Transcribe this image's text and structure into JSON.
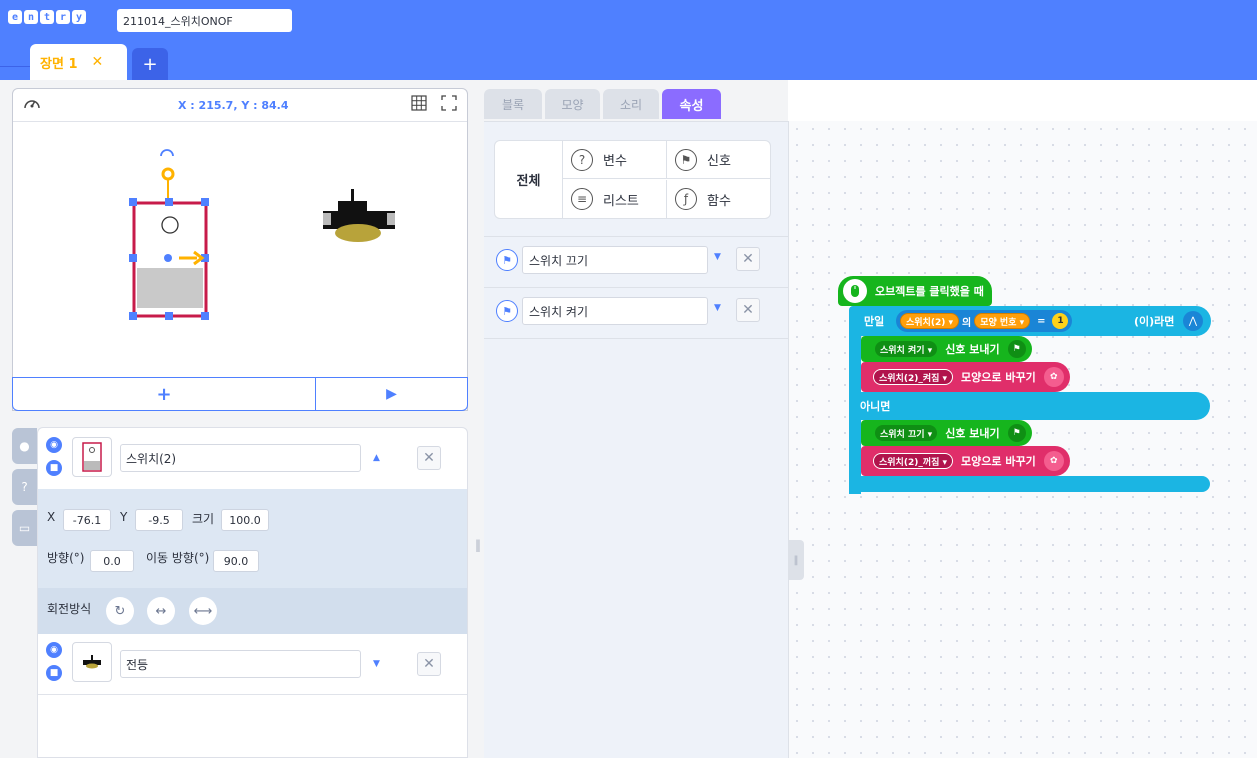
{
  "header": {
    "logo_letters": [
      "e",
      "n",
      "t",
      "r",
      "y"
    ],
    "project_title": "211014_스위치ONOF",
    "scene_tab": "장면 1",
    "scene_close": "✕",
    "scene_add": "+"
  },
  "stage": {
    "coords": "X : 215.7,  Y : 84.4",
    "add_button": "+",
    "play_button": "▶"
  },
  "objects": [
    {
      "name": "스위치(2)",
      "x_label": "X",
      "x": "-76.1",
      "y_label": "Y",
      "y": "-9.5",
      "size_label": "크기",
      "size": "100.0",
      "dir_label": "방향(°)",
      "direction": "0.0",
      "move_dir_label": "이동 방향(°)",
      "move_direction": "90.0",
      "rotation_label": "회전방식"
    },
    {
      "name": "전등"
    }
  ],
  "tabs": [
    "블록",
    "모양",
    "소리",
    "속성"
  ],
  "active_tab": "속성",
  "categories": {
    "all": "전체",
    "variable": "변수",
    "signal": "신호",
    "list": "리스트",
    "function": "함수"
  },
  "signals": [
    "스위치 끄기",
    "스위치 켜기"
  ],
  "code": {
    "hat": "오브젝트를 클릭했을 때",
    "if_label": "만일",
    "obj_sel": "스위치(2) ▾",
    "of": "의",
    "prop": "모양 번호 ▾",
    "eq": "=",
    "num": "1",
    "then": "(이)라면",
    "send1_sig": "스위치 켜기 ▾",
    "send_label": "신호 보내기",
    "shape1": "스위치(2)_켜짐 ▾",
    "change_label": "모양으로 바꾸기",
    "else_label": "아니면",
    "send2_sig": "스위치 끄기 ▾",
    "shape2": "스위치(2)_꺼짐 ▾"
  },
  "colors": {
    "header": "#4f80ff",
    "accent_orange": "#ffb200",
    "attr_tab": "#8b6cff",
    "event_green": "#16b51d",
    "flow_cyan": "#1bb5e3",
    "looks_pink": "#e02e6a"
  }
}
